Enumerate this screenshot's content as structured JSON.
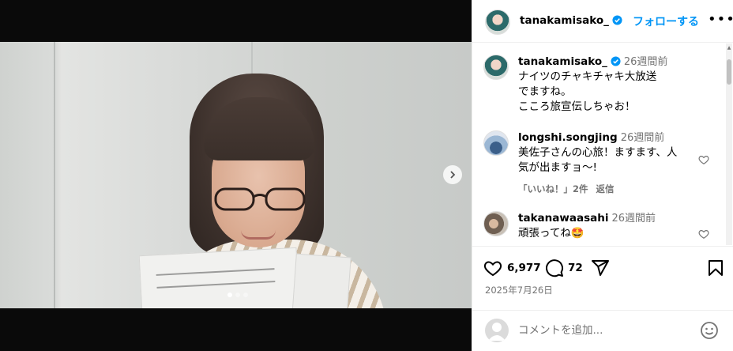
{
  "post": {
    "username": "tanakamisako_",
    "follow_label": "フォローする",
    "more_label": "•••",
    "date": "2025年7月26日",
    "likes": "6,977",
    "comments_count": "72",
    "carousel": {
      "slide_count": 3,
      "active_slide": 1
    }
  },
  "caption": {
    "username": "tanakamisako_",
    "time": "26週間前",
    "lines": [
      "ナイツのチャキチャキ大放送",
      "でますね。",
      "こころ旅宣伝しちゃお！"
    ]
  },
  "comments": [
    {
      "username": "longshi.songjing",
      "time": "26週間前",
      "lines": [
        "美佐子さんの心旅！ますます、人",
        "気が出ますョ〜!"
      ],
      "likes_label": "「いいね！」2件",
      "reply_label": "返信"
    },
    {
      "username": "takanawaasahi",
      "time": "26週間前",
      "text": "頑張ってね🤩"
    }
  ],
  "add_comment": {
    "placeholder": "コメントを追加..."
  },
  "icons": {
    "verified": "verified-badge-icon",
    "heart": "heart-icon",
    "comment": "comment-icon",
    "share": "share-icon",
    "save": "bookmark-icon",
    "emoji": "emoji-icon",
    "next": "chevron-right-icon"
  },
  "colors": {
    "accent": "#0095f6",
    "secondary_text": "#737373",
    "border": "#efefef"
  }
}
